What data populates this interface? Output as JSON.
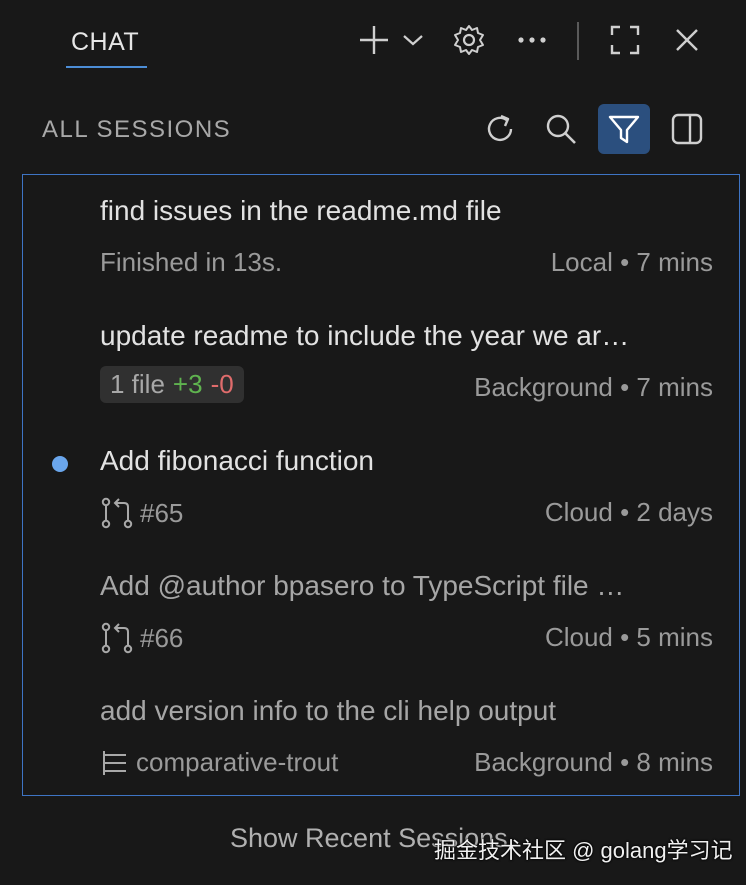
{
  "header": {
    "tab_label": "CHAT",
    "icons": [
      "plus-icon",
      "chevron-down-icon",
      "gear-icon",
      "more-icon",
      "maximize-icon",
      "close-icon"
    ]
  },
  "sessions": {
    "title": "ALL SESSIONS",
    "icons": [
      "refresh-icon",
      "search-icon",
      "filter-icon",
      "split-view-icon"
    ]
  },
  "items": [
    {
      "title": "find issues in the readme.md file",
      "sub": "Finished in 13s.",
      "meta": "Local • 7 mins"
    },
    {
      "title": "update readme to include the year we ar…",
      "chip_files": "1 file",
      "chip_added": "+3",
      "chip_removed": "-0",
      "meta": "Background • 7 mins"
    },
    {
      "title": "Add fibonacci function",
      "sub": "#65",
      "meta": "Cloud • 2 days",
      "unread": true
    },
    {
      "title": "Add @author bpasero to TypeScript file …",
      "sub": "#66",
      "meta": "Cloud • 5 mins"
    },
    {
      "title": "add version info to the cli help output",
      "sub": "comparative-trout",
      "meta": "Background • 8 mins"
    }
  ],
  "footer": {
    "show_recent": "Show Recent Sessions"
  },
  "watermark": "掘金技术社区 @ golang学习记",
  "colors": {
    "accent": "#4c8dd6",
    "active_button_bg": "#2b4f7e",
    "unread_dot": "#6aa6ec",
    "added": "#5fb34f",
    "removed": "#e06c6c"
  }
}
